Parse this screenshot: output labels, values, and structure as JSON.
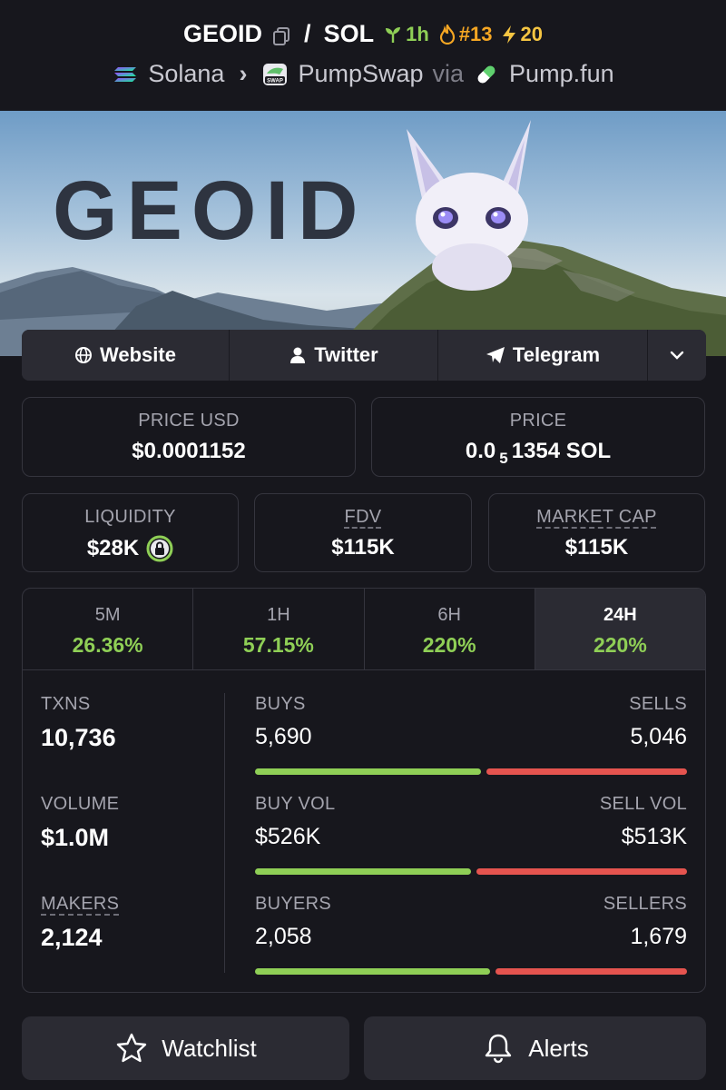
{
  "header": {
    "token": "GEOID",
    "quote": "SOL",
    "age_badge": "1h",
    "rank_badge": "#13",
    "boost_badge": "20",
    "chain": "Solana",
    "dex": "PumpSwap",
    "via_label": "via",
    "launchpad": "Pump.fun",
    "swap_logo_text": "SWAP"
  },
  "banner": {
    "title": "GEOID"
  },
  "links": {
    "website": "Website",
    "twitter": "Twitter",
    "telegram": "Telegram"
  },
  "stats": {
    "price_usd_label": "PRICE USD",
    "price_usd_value": "$0.0001152",
    "price_label": "PRICE",
    "price_prefix": "0.0",
    "price_zeros": "5",
    "price_suffix": "1354 SOL",
    "liquidity_label": "LIQUIDITY",
    "liquidity_value": "$28K",
    "fdv_label": "FDV",
    "fdv_value": "$115K",
    "mcap_label": "MARKET CAP",
    "mcap_value": "$115K"
  },
  "timeframes": [
    {
      "label": "5M",
      "change": "26.36%"
    },
    {
      "label": "1H",
      "change": "57.15%"
    },
    {
      "label": "6H",
      "change": "220%"
    },
    {
      "label": "24H",
      "change": "220%"
    }
  ],
  "activity": {
    "txns_label": "TXNS",
    "txns_value": "10,736",
    "volume_label": "VOLUME",
    "volume_value": "$1.0M",
    "makers_label": "MAKERS",
    "makers_value": "2,124",
    "buys_label": "BUYS",
    "buys_value": "5,690",
    "sells_label": "SELLS",
    "sells_value": "5,046",
    "buy_vol_label": "BUY VOL",
    "buy_vol_value": "$526K",
    "sell_vol_label": "SELL VOL",
    "sell_vol_value": "$513K",
    "buyers_label": "BUYERS",
    "buyers_value": "2,058",
    "sellers_label": "SELLERS",
    "sellers_value": "1,679",
    "buy_ratios": [
      0.53,
      0.506,
      0.551
    ]
  },
  "actions": {
    "watchlist": "Watchlist",
    "alerts": "Alerts"
  },
  "colors": {
    "background": "#17171d",
    "panel": "#2b2b33",
    "positive": "#8fcf56",
    "negative": "#e5544f",
    "accent_orange": "#f5a623"
  }
}
